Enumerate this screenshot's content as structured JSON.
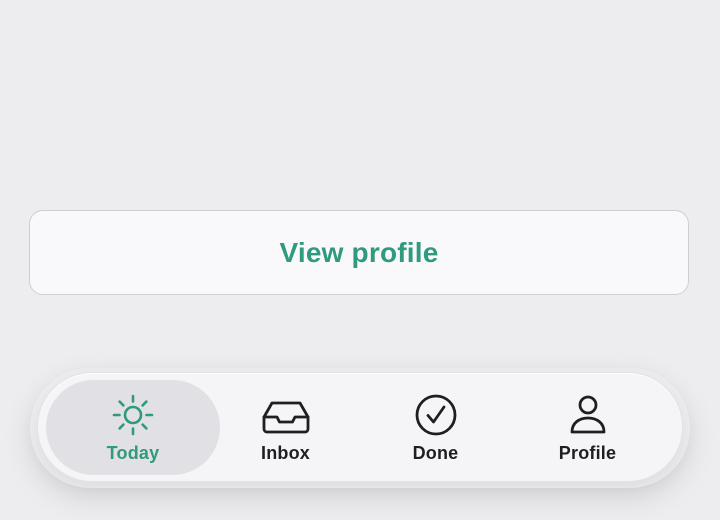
{
  "main": {
    "view_profile_label": "View profile"
  },
  "tabbar": {
    "active_tab": "today",
    "items": [
      {
        "id": "today",
        "label": "Today",
        "icon": "sun-icon"
      },
      {
        "id": "inbox",
        "label": "Inbox",
        "icon": "inbox-tray-icon"
      },
      {
        "id": "done",
        "label": "Done",
        "icon": "checkmark-circle-icon"
      },
      {
        "id": "profile",
        "label": "Profile",
        "icon": "person-icon"
      }
    ]
  },
  "colors": {
    "accent": "#2f9a7d",
    "background": "#ededef",
    "tab_text": "#1f1f22"
  }
}
